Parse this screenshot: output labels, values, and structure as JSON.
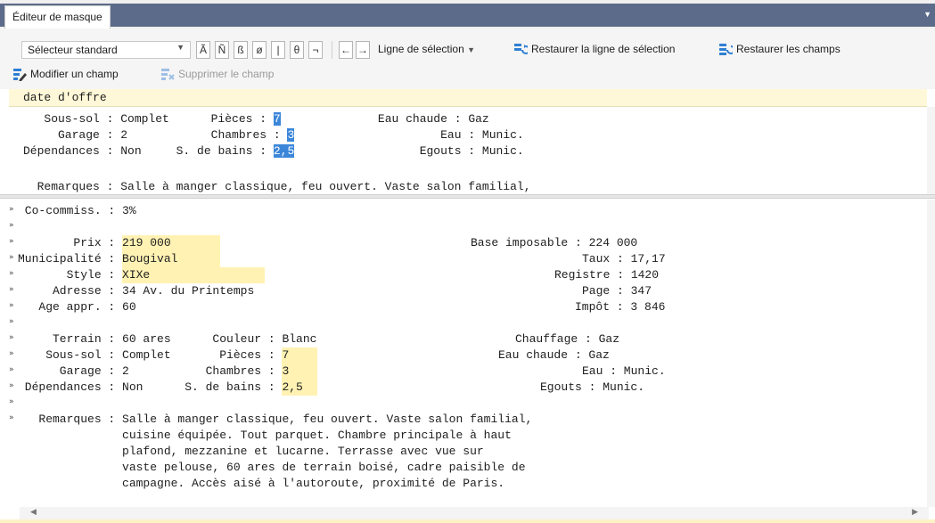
{
  "tab": {
    "title": "Éditeur de masque"
  },
  "toolbar": {
    "selector_value": "Sélecteur standard",
    "glyphs": [
      "Ã",
      "Ñ",
      "ß",
      "ø",
      "|",
      "θ",
      "¬"
    ],
    "nav_prev": "←",
    "nav_next": "→",
    "selection_line": "Ligne de sélection",
    "restore_selection": "Restaurer la ligne de sélection",
    "restore_fields": "Restaurer les champs",
    "modify_field": "Modifier un champ",
    "delete_field": "Supprimer le champ"
  },
  "header_field": "date d'offre",
  "top_pane": {
    "rows": [
      {
        "l_label": "   Sous-sol : ",
        "l_val": "Complet",
        "m_label": "      Pièces : ",
        "m_val": "7",
        "r_label": "              Eau chaude : ",
        "r_val": "Gaz"
      },
      {
        "l_label": "     Garage : ",
        "l_val": "2",
        "m_label": "            Chambres : ",
        "m_val": "3",
        "r_label": "                     Eau : ",
        "r_val": "Munic."
      },
      {
        "l_label": "Dépendances : ",
        "l_val": "Non",
        "m_label": "     S. de bains : ",
        "m_val": "2,5",
        "r_label": "                  Egouts : ",
        "r_val": "Munic."
      }
    ],
    "remarks": "  Remarques : Salle à manger classique, feu ouvert. Vaste salon familial,"
  },
  "bottom_pane": {
    "cocommiss": " Co-commiss. : 3%",
    "prix_label": "        Prix : ",
    "prix_val": "219 000",
    "base_label": "Base imposable : 224 000",
    "muni_label": "Municipalité : ",
    "muni_val": "Bougival",
    "taux_label": "Taux : 17,17",
    "style_label": "       Style : ",
    "style_val": "XIXe",
    "registre_label": "Registre : 1420",
    "adresse": "     Adresse : 34 Av. du Printemps",
    "page_label": "Page : 347",
    "age": "   Age appr. : 60",
    "impot_label": "Impôt : 3 846",
    "terrain": "     Terrain : 60 ares      Couleur : Blanc",
    "chauffage": "Chauffage : Gaz",
    "rows": [
      {
        "l": "    Sous-sol : Complet       Pièces : ",
        "v": "7",
        "r": "Eau chaude : Gaz"
      },
      {
        "l": "      Garage : 2           Chambres : ",
        "v": "3",
        "r": "Eau : Munic."
      },
      {
        "l": " Dépendances : Non      S. de bains : ",
        "v": "2,5",
        "r": "Egouts : Munic."
      }
    ],
    "remarks": [
      "   Remarques : Salle à manger classique, feu ouvert. Vaste salon familial,",
      "               cuisine équipée. Tout parquet. Chambre principale à haut",
      "               plafond, mezzanine et lucarne. Terrasse avec vue sur",
      "               vaste pelouse, 60 ares de terrain boisé, cadre paisible de",
      "               campagne. Accès aisé à l'autoroute, proximité de Paris."
    ]
  },
  "colors": {
    "tab_bar": "#5d6b8a",
    "highlight_blue": "#3b86d9",
    "highlight_yellow": "#fff2b3"
  }
}
